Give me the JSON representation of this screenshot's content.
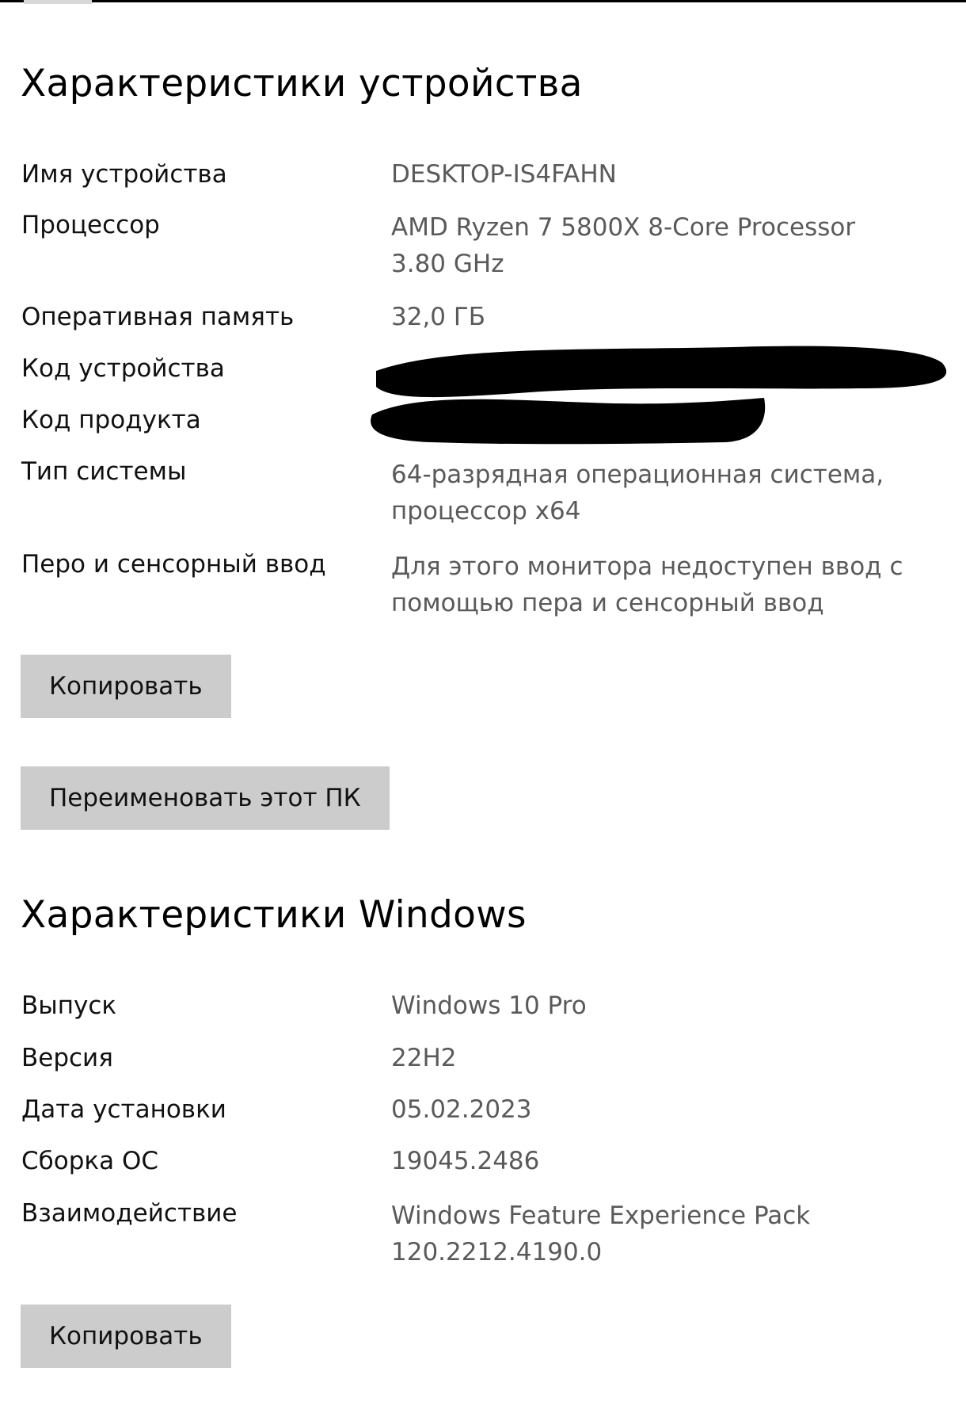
{
  "device": {
    "title": "Характеристики устройства",
    "rows": [
      {
        "label": "Имя устройства",
        "value": [
          "DESKTOP-IS4FAHN"
        ]
      },
      {
        "label": "Процессор",
        "value": [
          "AMD Ryzen 7 5800X 8-Core Processor",
          "3.80 GHz"
        ]
      },
      {
        "label": "Оперативная память",
        "value": [
          "32,0 ГБ"
        ]
      },
      {
        "label": "Код устройства",
        "value": []
      },
      {
        "label": "Код продукта",
        "value": []
      },
      {
        "label": "Тип системы",
        "value": [
          "64-разрядная операционная система,",
          "процессор x64"
        ]
      },
      {
        "label": "Перо и сенсорный ввод",
        "value": [
          "Для этого монитора недоступен ввод с",
          "помощью пера и сенсорный ввод"
        ]
      }
    ],
    "copy_label": "Копировать",
    "rename_label": "Переименовать этот ПК"
  },
  "windows": {
    "title": "Характеристики Windows",
    "rows": [
      {
        "label": "Выпуск",
        "value": [
          "Windows 10 Pro"
        ]
      },
      {
        "label": "Версия",
        "value": [
          "22H2"
        ]
      },
      {
        "label": "Дата установки",
        "value": [
          "05.02.2023"
        ]
      },
      {
        "label": "Сборка ОС",
        "value": [
          "19045.2486"
        ]
      },
      {
        "label": "Взаимодействие",
        "value": [
          "Windows Feature Experience Pack",
          "120.2212.4190.0"
        ]
      }
    ],
    "copy_label": "Копировать"
  },
  "colors": {
    "label_text": "#111111",
    "value_text": "#5a5a5a",
    "button_bg": "#cccccc",
    "redaction": "#000000"
  }
}
